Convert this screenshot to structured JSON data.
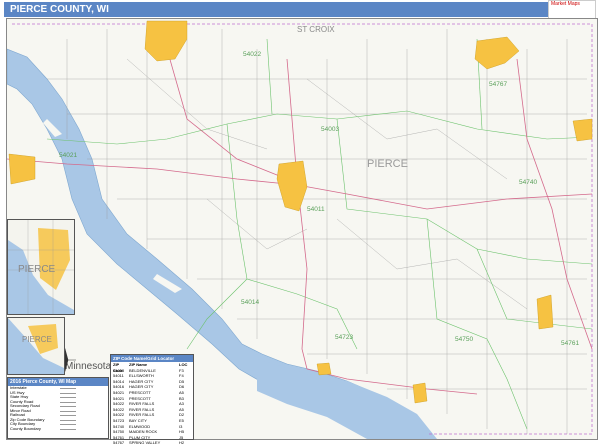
{
  "header": {
    "title": "PIERCE COUNTY, WI"
  },
  "logo": {
    "line1": "Market Maps",
    "line2": ""
  },
  "map": {
    "county_label": "PIERCE",
    "neighbor_label": "ST CROIX",
    "zip_labels": [
      {
        "code": "54022"
      },
      {
        "code": "54767"
      },
      {
        "code": "54003"
      },
      {
        "code": "54021"
      },
      {
        "code": "54011"
      },
      {
        "code": "54740"
      },
      {
        "code": "54014"
      },
      {
        "code": "54723"
      },
      {
        "code": "54750"
      },
      {
        "code": "54761"
      }
    ],
    "state_label": "Minnesota",
    "inset_top_label": "PIERCE",
    "inset_bottom_label": "PIERCE"
  },
  "legend": {
    "title": "2016 Pierce County, WI Map",
    "items": [
      "Interstate",
      "US Hwy",
      "State Hwy",
      "County Road",
      "Secondary Road",
      "Minor Road",
      "Railroad",
      "Zip Code Boundary",
      "City Boundary",
      "County Boundary"
    ]
  },
  "zip_table": {
    "title": "ZIP Code Name/Grid Locator",
    "headers": [
      "ZIP Code",
      "ZIP Name",
      "LOC"
    ],
    "rows": [
      [
        "54003",
        "BELDENVILLE",
        "F3"
      ],
      [
        "54011",
        "ELLSWORTH",
        "F4"
      ],
      [
        "54014",
        "HAGER CITY",
        "D5"
      ],
      [
        "54016",
        "HAGER CITY",
        "D6"
      ],
      [
        "54021",
        "PRESCOTT",
        "A5"
      ],
      [
        "54021",
        "PRESCOTT",
        "B3"
      ],
      [
        "54022",
        "RIVER FALLS",
        "A3"
      ],
      [
        "54022",
        "RIVER FALLS",
        "A5"
      ],
      [
        "54022",
        "RIVER FALLS",
        "D2"
      ],
      [
        "54723",
        "BAY CITY",
        "E5"
      ],
      [
        "54740",
        "ELMWOOD",
        "I3"
      ],
      [
        "54750",
        "MAIDEN ROCK",
        "H5"
      ],
      [
        "54761",
        "PLUM CITY",
        "J5"
      ],
      [
        "54767",
        "SPRING VALLEY",
        "H2"
      ]
    ]
  },
  "colors": {
    "header_bg": "#5b86c5",
    "water": "#a9c7e6",
    "city": "#f6c242",
    "zip_boundary": "#6cc26c",
    "roads": "#d46a8c",
    "minor_roads": "#9a9a9a"
  }
}
